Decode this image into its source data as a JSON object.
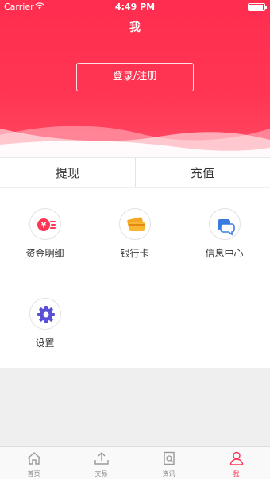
{
  "status_bar": {
    "carrier": "Carrier",
    "time": "4:49 PM",
    "battery_level": 0.95
  },
  "header": {
    "title": "我",
    "login_label": "登录/注册"
  },
  "actions": {
    "withdraw": "提现",
    "recharge": "充值"
  },
  "menu": [
    {
      "label": "资金明细",
      "icon": "money-details-icon"
    },
    {
      "label": "银行卡",
      "icon": "bank-card-icon"
    },
    {
      "label": "信息中心",
      "icon": "message-center-icon"
    },
    {
      "label": "设置",
      "icon": "settings-gear-icon"
    }
  ],
  "tabs": [
    {
      "label": "首页",
      "icon": "home-icon"
    },
    {
      "label": "交易",
      "icon": "trade-icon"
    },
    {
      "label": "资讯",
      "icon": "news-icon"
    },
    {
      "label": "我",
      "icon": "user-icon",
      "active": true
    }
  ],
  "colors": {
    "accent": "#ff3553",
    "blue": "#3a7be0",
    "purple": "#5b4fd6",
    "orange": "#f5a623"
  }
}
